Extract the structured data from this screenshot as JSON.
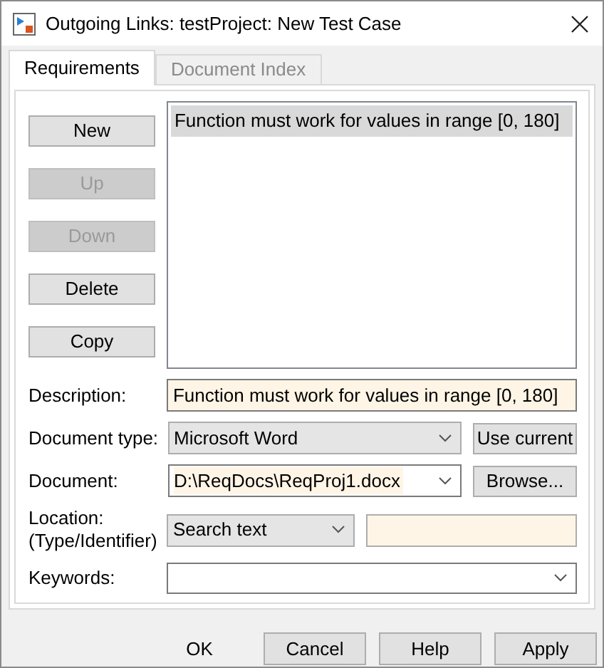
{
  "window": {
    "title": "Outgoing Links: testProject: New Test Case"
  },
  "tabs": [
    {
      "label": "Requirements",
      "selected": true
    },
    {
      "label": "Document Index",
      "selected": false
    }
  ],
  "side_buttons": [
    {
      "label": "New",
      "disabled": false
    },
    {
      "label": "Up",
      "disabled": true
    },
    {
      "label": "Down",
      "disabled": true
    },
    {
      "label": "Delete",
      "disabled": false
    },
    {
      "label": "Copy",
      "disabled": false
    }
  ],
  "requirements": [
    {
      "text": "Function must work for values in range [0, 180]",
      "selected": true
    }
  ],
  "form": {
    "description": {
      "label": "Description:",
      "value": "Function must work for values in range [0, 180]"
    },
    "document_type": {
      "label": "Document type:",
      "value": "Microsoft Word",
      "button": "Use current"
    },
    "document": {
      "label": "Document:",
      "value": "D:\\ReqDocs\\ReqProj1.docx",
      "button": "Browse..."
    },
    "location": {
      "label": "Location:",
      "sublabel": "(Type/Identifier)",
      "type": "Search text"
    },
    "keywords": {
      "label": "Keywords:"
    }
  },
  "footer_buttons": [
    {
      "label": "OK",
      "kind": "flat"
    },
    {
      "label": "Cancel",
      "kind": "raised"
    },
    {
      "label": "Help",
      "kind": "raised"
    },
    {
      "label": "Apply",
      "kind": "raised"
    }
  ]
}
